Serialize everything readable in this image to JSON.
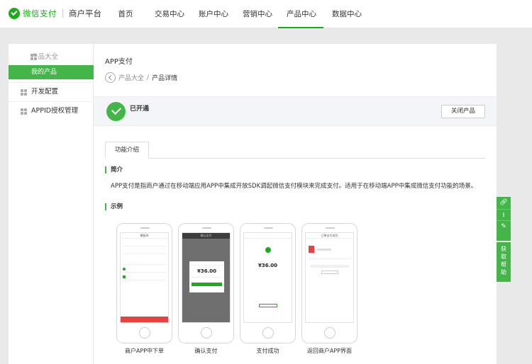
{
  "brand": {
    "title": "微信支付",
    "subtitle": "商户平台"
  },
  "nav": [
    {
      "label": "首页"
    },
    {
      "label": "交易中心"
    },
    {
      "label": "账户中心"
    },
    {
      "label": "营销中心"
    },
    {
      "label": "产品中心"
    },
    {
      "label": "数据中心"
    }
  ],
  "sidebar": {
    "group": "产品大全",
    "active_item": "我的产品",
    "items": [
      {
        "label": "开发配置"
      },
      {
        "label": "APPID授权管理"
      }
    ]
  },
  "main": {
    "title": "APP支付",
    "breadcrumb": {
      "parent": "产品大全",
      "separator": "/",
      "current": "产品详情"
    },
    "status": "已开通",
    "close_button": "关闭产品",
    "tab": "功能介绍",
    "intro_title": "简介",
    "intro_text": "APP支付是指商户通过在移动端应用APP中集成开放SDK调起微信支付模块来完成支付。适用于在移动端APP中集成微信支付功能的场景。",
    "example_title": "示例"
  },
  "phones": [
    {
      "caption": "商户APP中下单",
      "header": "模板块"
    },
    {
      "caption": "确认支付",
      "header": "确认支付",
      "amount": "¥36.00",
      "button": "确认支付"
    },
    {
      "caption": "支付成功",
      "amount": "¥36.00"
    },
    {
      "caption": "返回商户APP界面",
      "header": "订单支付成功"
    }
  ],
  "floating": {
    "help": "获取帮助"
  },
  "colors": {
    "accent": "#1aad19",
    "accent_light": "#44b549"
  }
}
